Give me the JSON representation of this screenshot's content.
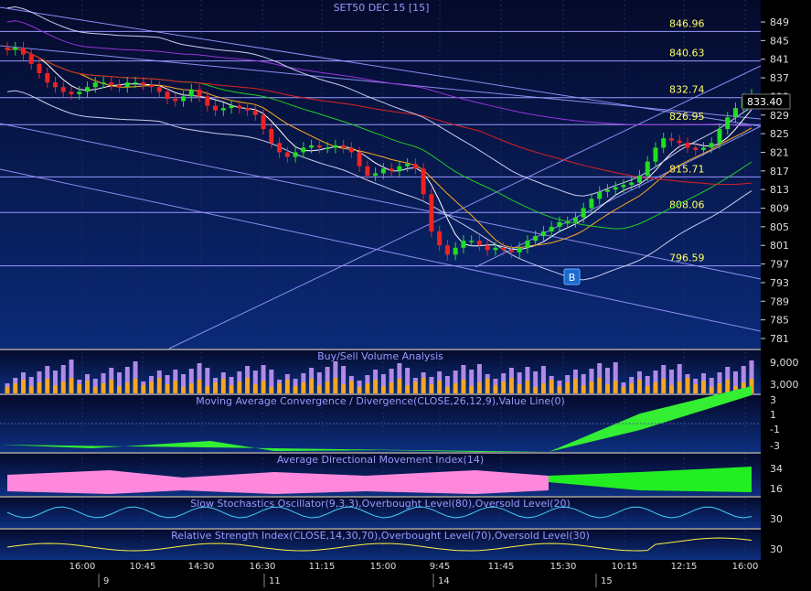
{
  "chart_title": "SET50 DEC 15  [15]",
  "price_axis": {
    "ticks": [
      849,
      845,
      841,
      837,
      833,
      829,
      825,
      821,
      817,
      813,
      809,
      805,
      801,
      797,
      793,
      789,
      785,
      781
    ],
    "last_price": "833.40"
  },
  "horizontal_levels": [
    {
      "label": "846.96",
      "value": 846.96
    },
    {
      "label": "840.63",
      "value": 840.63
    },
    {
      "label": "832.74",
      "value": 832.74
    },
    {
      "label": "826.95",
      "value": 826.95
    },
    {
      "label": "815.71",
      "value": 815.71
    },
    {
      "label": "808.06",
      "value": 808.06
    },
    {
      "label": "796.59",
      "value": 796.59
    }
  ],
  "signal_marker": "B",
  "panels": [
    {
      "id": "volume",
      "title": "Buy/Sell Volume Analysis",
      "ticks": [
        "9,000",
        "3,000"
      ]
    },
    {
      "id": "macd",
      "title": "Moving Average Convergence / Divergence(CLOSE,26,12,9),Value Line(0)",
      "ticks": [
        "3",
        "1",
        "-1",
        "-3"
      ]
    },
    {
      "id": "adx",
      "title": "Average Directional Movement Index(14)",
      "ticks": [
        "34",
        "16"
      ]
    },
    {
      "id": "stoch",
      "title": "Slow Stochastics Oscillator(9,3,3),Overbought Level(80),Oversold Level(20)",
      "ticks": [
        "30"
      ]
    },
    {
      "id": "rsi",
      "title": "Relative Strength Index(CLOSE,14,30,70),Overbought Level(70),Oversold Level(30)",
      "ticks": [
        "30"
      ]
    }
  ],
  "time_axis": {
    "times": [
      "16:00",
      "10:45",
      "14:30",
      "16:30",
      "11:15",
      "15:00",
      "9:45",
      "11:45",
      "15:30",
      "10:15",
      "12:15",
      "16:00"
    ],
    "days": [
      "9",
      "11",
      "14",
      "15"
    ]
  },
  "colors": {
    "up": "#22dd22",
    "down": "#ee2222",
    "buy_vol": "#f5a623",
    "sell_vol": "#b08ae8",
    "macd_hist": "#33ee33",
    "adx_fill": "#ff88dd",
    "level_line": "#9999ff",
    "level_label": "#ffff66"
  },
  "chart_data": {
    "type": "candlestick",
    "title": "SET50 DEC 15  [15]",
    "y_range": [
      781,
      851
    ],
    "closes": [
      843,
      843.5,
      842,
      840,
      838,
      836,
      835,
      834,
      833.5,
      834,
      835,
      836,
      836,
      835.5,
      835,
      836,
      836,
      835.5,
      835,
      834,
      832.5,
      832,
      833,
      834.5,
      833,
      831,
      830,
      830.5,
      831,
      830.5,
      830,
      829,
      826,
      823,
      821,
      820,
      821,
      822,
      822.5,
      822,
      822,
      822.5,
      822,
      821,
      818,
      816,
      816.5,
      817.5,
      817,
      818,
      818.5,
      817.5,
      812,
      804,
      801,
      799,
      800.5,
      802,
      802,
      801,
      800,
      800.5,
      800,
      799.5,
      800.5,
      802,
      803,
      804,
      805,
      806,
      806,
      807,
      809,
      811,
      812.5,
      813,
      813.5,
      814,
      814.5,
      816,
      819,
      822,
      824,
      823.5,
      823,
      822,
      821.5,
      822,
      823,
      826,
      828.5,
      830.5,
      832.5,
      833.4
    ],
    "volume_buy_sell_approx": "per-bar buy/sell volume bars, scale 0-9000"
  }
}
